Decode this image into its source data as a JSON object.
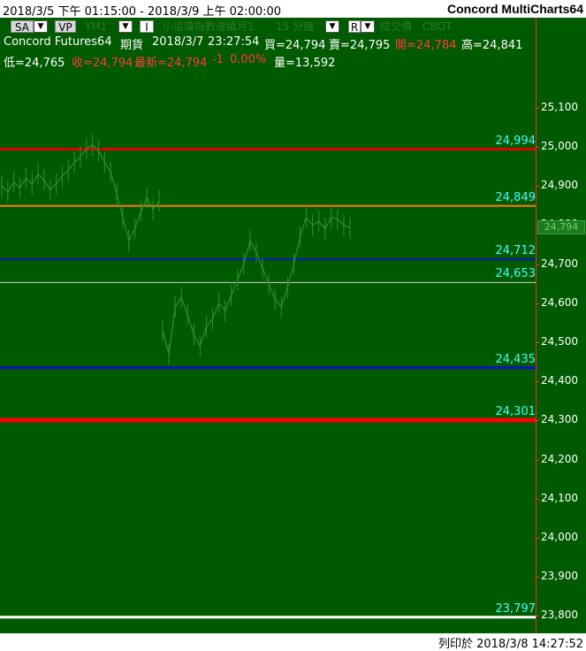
{
  "window": {
    "date_range": "2018/3/5 下午 01:15:00 - 2018/3/9 上午 02:00:00",
    "app_title": "Concord MultiCharts64"
  },
  "toolbar": {
    "sa_label": "SA",
    "vp_label": "VP",
    "symbol": "YM1",
    "indicator_label": "I",
    "contract_name": "小道瓊指數連續月1",
    "interval": "15 分鐘",
    "r_label": "R",
    "data_type": "成交價",
    "exchange": "CBOT"
  },
  "quote": {
    "source": "Concord Futures64",
    "kind": "期貨",
    "datetime": "2018/3/7",
    "time": "23:27:54",
    "bid": "買=24,794",
    "ask": "賣=24,795",
    "open": "開=24,784",
    "high": "高=24,841",
    "low": "低=24,765",
    "close": "收=24,794",
    "last": "最新=24,794",
    "change": "-1",
    "change_pct": "0.00%",
    "volume": "量=13,592"
  },
  "colors": {
    "background": "#005a00",
    "price_bars": "#2f8f2f",
    "axis_border": "#ff2a2a",
    "level_label": "#40ffff"
  },
  "chart_data": {
    "type": "line",
    "y_ticks": [
      "25,100",
      "25,000",
      "24,900",
      "24,800",
      "24,700",
      "24,600",
      "24,500",
      "24,400",
      "24,300",
      "24,200",
      "24,100",
      "24,000",
      "23,900",
      "23,800"
    ],
    "ylim": [
      23775,
      25200
    ],
    "current_price": "24,794",
    "levels": [
      {
        "label": "24,994",
        "value": 24994,
        "color": "#e00000",
        "width": 3
      },
      {
        "label": "24,849",
        "value": 24849,
        "color": "#ff7a00",
        "width": 2
      },
      {
        "label": "24,712",
        "value": 24712,
        "color": "#1010c0",
        "width": 2
      },
      {
        "label": "24,653",
        "value": 24653,
        "color": "#d0d0d0",
        "width": 1
      },
      {
        "label": "24,435",
        "value": 24435,
        "color": "#1010c0",
        "width": 3
      },
      {
        "label": "24,301",
        "value": 24301,
        "color": "#ff0000",
        "width": 5
      },
      {
        "label": "23,797",
        "value": 23797,
        "color": "#ffffff",
        "width": 3
      }
    ],
    "series": [
      {
        "values": [
          24900,
          24885,
          24910,
          24895,
          24920,
          24905,
          24930,
          24915,
          24890,
          24905,
          24925,
          24940,
          24960,
          24975,
          24995,
          25005,
          24990,
          24960,
          24935,
          24880,
          24820,
          24760,
          24790,
          24835,
          24870,
          24840,
          24862,
          24530,
          24470,
          24590,
          24615,
          24570,
          24520,
          24490,
          24540,
          24560,
          24600,
          24580,
          24620,
          24660,
          24700,
          24760,
          24730,
          24690,
          24650,
          24610,
          24590,
          24640,
          24700,
          24770,
          24820,
          24800,
          24810,
          24790,
          24820,
          24815,
          24800,
          24792
        ]
      }
    ]
  },
  "footer": {
    "printed": "列印於 2018/3/8 14:27:52"
  }
}
